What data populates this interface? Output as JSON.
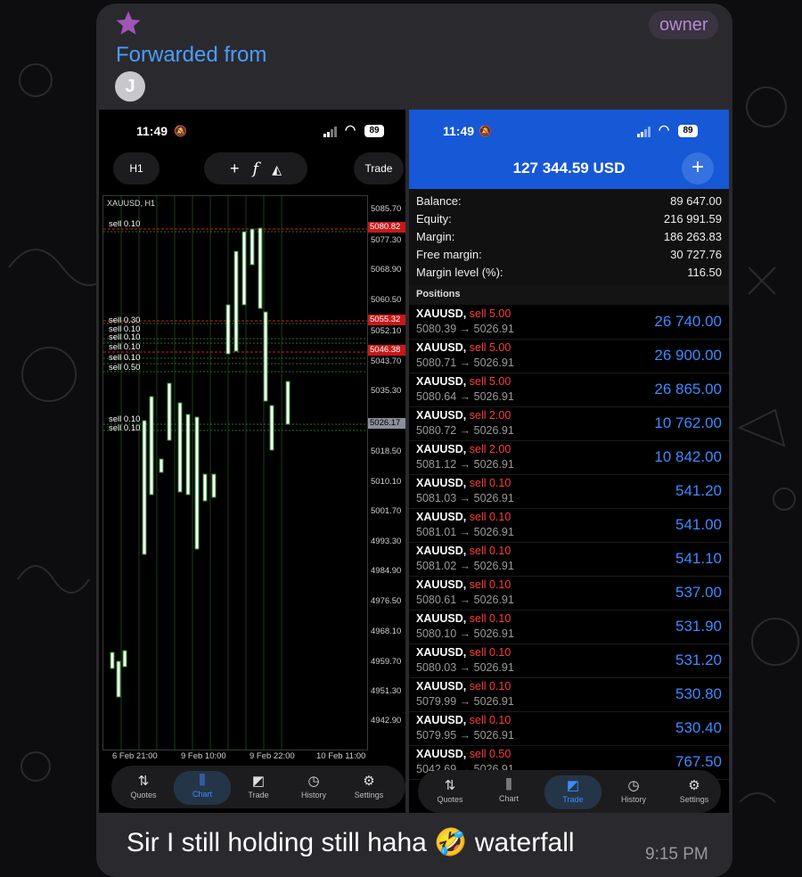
{
  "message": {
    "badge": "owner",
    "forwarded_label": "Forwarded from",
    "avatar_initial": "J",
    "caption": "Sir I still holding still haha 🤣 waterfall",
    "time": "9:15 PM"
  },
  "left_phone": {
    "status": {
      "time": "11:49",
      "battery": "89"
    },
    "toolbar": {
      "timeframe": "H1",
      "trade_label": "Trade"
    },
    "symbol_label": "XAUUSD, H1",
    "price_axis": [
      "5085.70",
      "5077.30",
      "5068.90",
      "5060.50",
      "5052.10",
      "5043.70",
      "5035.30",
      "5018.50",
      "5010.10",
      "5001.70",
      "4993.30",
      "4984.90",
      "4976.50",
      "4968.10",
      "4959.70",
      "4951.30",
      "4942.90"
    ],
    "price_tags": {
      "red1": "5080.82",
      "red2": "5055.32",
      "red3": "5046.38",
      "current": "5026.17"
    },
    "order_labels": [
      "sell 0.10",
      "sell 0.30",
      "sell 0.10",
      "sell 0.10",
      "sell 0.10",
      "sell 0.10",
      "sell 0.50",
      "sell 0.10",
      "sell 0.10"
    ],
    "date_axis": [
      "6 Feb 21:00",
      "9 Feb 10:00",
      "9 Feb 22:00",
      "10 Feb 11:00"
    ],
    "nav": [
      "Quotes",
      "Chart",
      "Trade",
      "History",
      "Settings"
    ]
  },
  "right_phone": {
    "status": {
      "time": "11:49",
      "battery": "89"
    },
    "total": "127 344.59 USD",
    "account": [
      {
        "label": "Balance:",
        "value": "89 647.00"
      },
      {
        "label": "Equity:",
        "value": "216 991.59"
      },
      {
        "label": "Margin:",
        "value": "186 263.83"
      },
      {
        "label": "Free margin:",
        "value": "30 727.76"
      },
      {
        "label": "Margin level (%):",
        "value": "116.50"
      }
    ],
    "positions_label": "Positions",
    "positions": [
      {
        "symbol": "XAUUSD,",
        "action": "sell 5.00",
        "prices": "5080.39 → 5026.91",
        "profit": "26 740.00"
      },
      {
        "symbol": "XAUUSD,",
        "action": "sell 5.00",
        "prices": "5080.71 → 5026.91",
        "profit": "26 900.00"
      },
      {
        "symbol": "XAUUSD,",
        "action": "sell 5.00",
        "prices": "5080.64 → 5026.91",
        "profit": "26 865.00"
      },
      {
        "symbol": "XAUUSD,",
        "action": "sell 2.00",
        "prices": "5080.72 → 5026.91",
        "profit": "10 762.00"
      },
      {
        "symbol": "XAUUSD,",
        "action": "sell 2.00",
        "prices": "5081.12 → 5026.91",
        "profit": "10 842.00"
      },
      {
        "symbol": "XAUUSD,",
        "action": "sell 0.10",
        "prices": "5081.03 → 5026.91",
        "profit": "541.20"
      },
      {
        "symbol": "XAUUSD,",
        "action": "sell 0.10",
        "prices": "5081.01 → 5026.91",
        "profit": "541.00"
      },
      {
        "symbol": "XAUUSD,",
        "action": "sell 0.10",
        "prices": "5081.02 → 5026.91",
        "profit": "541.10"
      },
      {
        "symbol": "XAUUSD,",
        "action": "sell 0.10",
        "prices": "5080.61 → 5026.91",
        "profit": "537.00"
      },
      {
        "symbol": "XAUUSD,",
        "action": "sell 0.10",
        "prices": "5080.10 → 5026.91",
        "profit": "531.90"
      },
      {
        "symbol": "XAUUSD,",
        "action": "sell 0.10",
        "prices": "5080.03 → 5026.91",
        "profit": "531.20"
      },
      {
        "symbol": "XAUUSD,",
        "action": "sell 0.10",
        "prices": "5079.99 → 5026.91",
        "profit": "530.80"
      },
      {
        "symbol": "XAUUSD,",
        "action": "sell 0.10",
        "prices": "5079.95 → 5026.91",
        "profit": "530.40"
      },
      {
        "symbol": "XAUUSD,",
        "action": "sell 0.50",
        "prices": "5042.69 → 5026.91",
        "profit": "767.50"
      }
    ],
    "nav": [
      "Quotes",
      "Chart",
      "Trade",
      "History",
      "Settings"
    ]
  },
  "colors": {
    "accent_blue": "#3d8bff",
    "header_blue": "#1658d6",
    "sell_red": "#ff3b3b",
    "bubble": "#2a2a2e"
  }
}
